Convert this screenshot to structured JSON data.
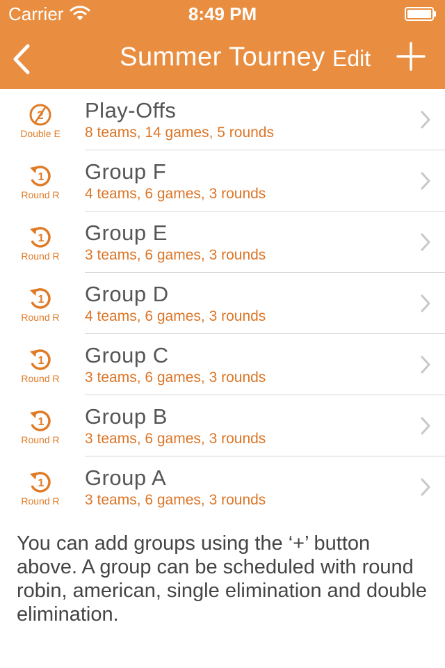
{
  "status_bar": {
    "carrier": "Carrier",
    "time": "8:49 PM",
    "wifi_icon": "wifi-icon",
    "battery_icon": "battery-icon"
  },
  "nav": {
    "title": "Summer Tourney",
    "back_icon": "chevron-left-icon",
    "edit_label": "Edit",
    "add_icon": "plus-icon"
  },
  "colors": {
    "accent": "#E98E40",
    "detail_text": "#DC7526",
    "name_text": "#555555",
    "separator": "#D6D6D6"
  },
  "groups": [
    {
      "name": "Play-Offs",
      "detail": "8 teams, 14 games, 5 rounds",
      "badge_number": "2",
      "badge_label": "Double E",
      "badge_icon": "double-elimination-icon"
    },
    {
      "name": "Group F",
      "detail": "4 teams, 6 games, 3 rounds",
      "badge_number": "1",
      "badge_label": "Round R",
      "badge_icon": "round-robin-icon"
    },
    {
      "name": "Group E",
      "detail": "3 teams, 6 games, 3 rounds",
      "badge_number": "1",
      "badge_label": "Round R",
      "badge_icon": "round-robin-icon"
    },
    {
      "name": "Group D",
      "detail": "4 teams, 6 games, 3 rounds",
      "badge_number": "1",
      "badge_label": "Round R",
      "badge_icon": "round-robin-icon"
    },
    {
      "name": "Group C",
      "detail": "3 teams, 6 games, 3 rounds",
      "badge_number": "1",
      "badge_label": "Round R",
      "badge_icon": "round-robin-icon"
    },
    {
      "name": "Group B",
      "detail": "3 teams, 6 games, 3 rounds",
      "badge_number": "1",
      "badge_label": "Round R",
      "badge_icon": "round-robin-icon"
    },
    {
      "name": "Group A",
      "detail": "3 teams, 6 games, 3 rounds",
      "badge_number": "1",
      "badge_label": "Round R",
      "badge_icon": "round-robin-icon"
    }
  ],
  "footer_text": "You can add groups using the ‘+’ button above. A group can be scheduled with round robin, american, single elimination and double elimination."
}
